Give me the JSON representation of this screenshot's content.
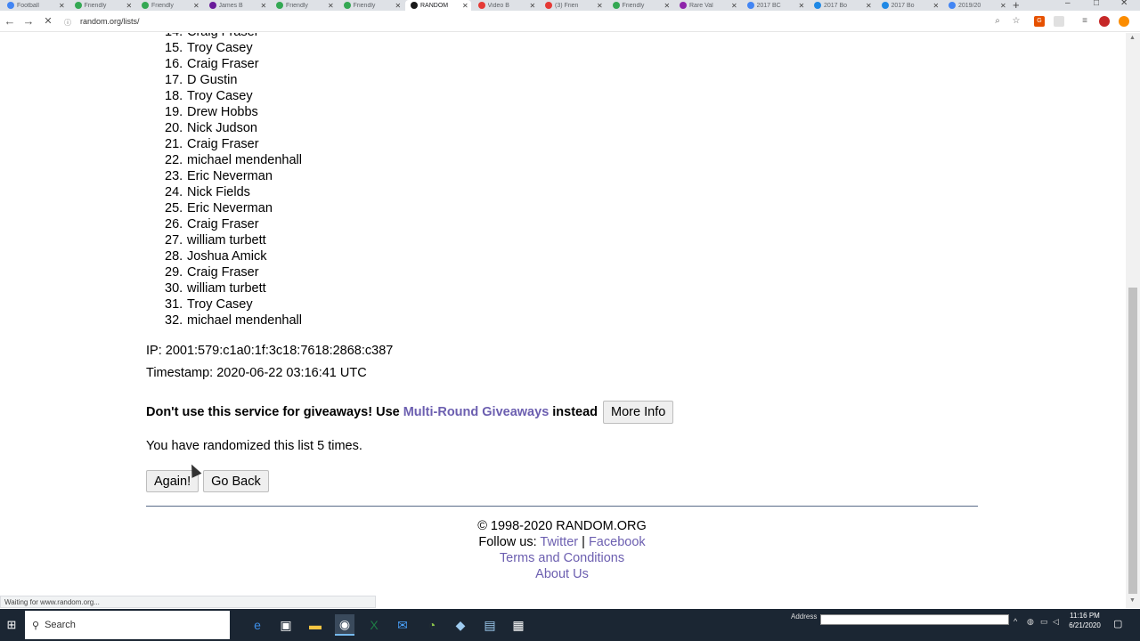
{
  "browser": {
    "tabs": [
      {
        "label": "Football",
        "color": "#4285f4",
        "active": false
      },
      {
        "label": "Friendly",
        "color": "#34a853",
        "active": false
      },
      {
        "label": "Friendly",
        "color": "#34a853",
        "active": false
      },
      {
        "label": "James B",
        "color": "#6a1b9a",
        "active": false
      },
      {
        "label": "Friendly",
        "color": "#34a853",
        "active": false
      },
      {
        "label": "Friendly",
        "color": "#34a853",
        "active": false
      },
      {
        "label": "RANDOM",
        "color": "#ffffff",
        "active": true
      },
      {
        "label": "Video B",
        "color": "#e53935",
        "active": false
      },
      {
        "label": "(3) Frien",
        "color": "#e53935",
        "active": false
      },
      {
        "label": "Friendly",
        "color": "#34a853",
        "active": false
      },
      {
        "label": "Rare Val",
        "color": "#8e24aa",
        "active": false
      },
      {
        "label": "2017 BC",
        "color": "#4285f4",
        "active": false
      },
      {
        "label": "2017 Bo",
        "color": "#1e88e5",
        "active": false
      },
      {
        "label": "2017 Bo",
        "color": "#1e88e5",
        "active": false
      },
      {
        "label": "2019/20",
        "color": "#4285f4",
        "active": false
      }
    ],
    "url": "random.org/lists/",
    "status_text": "Waiting for www.random.org..."
  },
  "list": {
    "partial_item": "Craig Fraser",
    "items": [
      {
        "num": "15.",
        "name": "Troy Casey"
      },
      {
        "num": "16.",
        "name": "Craig Fraser"
      },
      {
        "num": "17.",
        "name": "D Gustin"
      },
      {
        "num": "18.",
        "name": "Troy Casey"
      },
      {
        "num": "19.",
        "name": "Drew Hobbs"
      },
      {
        "num": "20.",
        "name": "Nick Judson"
      },
      {
        "num": "21.",
        "name": "Craig Fraser"
      },
      {
        "num": "22.",
        "name": "michael mendenhall"
      },
      {
        "num": "23.",
        "name": "Eric Neverman"
      },
      {
        "num": "24.",
        "name": "Nick Fields"
      },
      {
        "num": "25.",
        "name": "Eric Neverman"
      },
      {
        "num": "26.",
        "name": "Craig Fraser"
      },
      {
        "num": "27.",
        "name": "william turbett"
      },
      {
        "num": "28.",
        "name": "Joshua Amick"
      },
      {
        "num": "29.",
        "name": "Craig Fraser"
      },
      {
        "num": "30.",
        "name": "william turbett"
      },
      {
        "num": "31.",
        "name": "Troy Casey"
      },
      {
        "num": "32.",
        "name": "michael mendenhall"
      }
    ]
  },
  "info": {
    "ip": "IP: 2001:579:c1a0:1f:3c18:7618:2868:c387",
    "timestamp": "Timestamp: 2020-06-22 03:16:41 UTC"
  },
  "giveaway": {
    "prefix": "Don't use this service for giveaways! Use",
    "link": "Multi-Round Giveaways",
    "suffix": "instead",
    "more_info_label": "More Info"
  },
  "randomized_text": "You have randomized this list 5 times.",
  "actions": {
    "again_label": "Again!",
    "back_label": "Go Back"
  },
  "footer": {
    "copyright": "© 1998-2020 RANDOM.ORG",
    "follow_prefix": "Follow us:",
    "twitter": "Twitter",
    "separator": "|",
    "facebook": "Facebook",
    "terms": "Terms and Conditions",
    "about": "About Us"
  },
  "taskbar": {
    "search_label": "Search",
    "address_label": "Address",
    "time": "11:16 PM",
    "date": "6/21/2020"
  },
  "colors": {
    "link": "#6c5fb0",
    "taskbar": "#1b2633"
  }
}
